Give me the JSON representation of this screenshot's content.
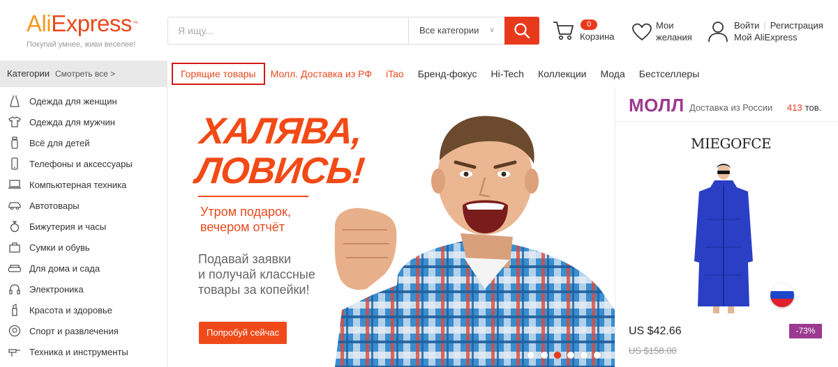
{
  "header": {
    "logo": {
      "ali": "Ali",
      "express": "Express",
      "tm": "™",
      "tagline": "Покупай умнее, живи веселее!"
    },
    "search": {
      "placeholder": "Я ищу...",
      "category": "Все категории",
      "button_icon": "search-icon"
    },
    "cart": {
      "count": "0",
      "label": "Корзина",
      "icon": "cart-icon"
    },
    "wishlist": {
      "line1": "Мои",
      "line2": "желания",
      "icon": "heart-icon"
    },
    "account": {
      "login": "Войти",
      "register": "Регистрация",
      "mine": "Мой AliExpress",
      "icon": "user-icon"
    }
  },
  "nav": {
    "categories_title": "Категории",
    "see_all": "Смотреть все >",
    "links": [
      {
        "label": "Горящие товары",
        "style": "hot"
      },
      {
        "label": "Молл. Доставка из РФ",
        "style": "orange"
      },
      {
        "label": "iTao",
        "style": "orange"
      },
      {
        "label": "Бренд-фокус",
        "style": "normal"
      },
      {
        "label": "Hi-Tech",
        "style": "normal"
      },
      {
        "label": "Коллекции",
        "style": "normal"
      },
      {
        "label": "Мода",
        "style": "normal"
      },
      {
        "label": "Бестселлеры",
        "style": "normal"
      }
    ]
  },
  "sidebar": {
    "items": [
      {
        "label": "Одежда для женщин",
        "icon": "dress-icon"
      },
      {
        "label": "Одежда для мужчин",
        "icon": "shirt-icon"
      },
      {
        "label": "Всё для детей",
        "icon": "baby-bottle-icon"
      },
      {
        "label": "Телефоны и аксессуары",
        "icon": "phone-icon"
      },
      {
        "label": "Компьютерная техника",
        "icon": "laptop-icon"
      },
      {
        "label": "Автотовары",
        "icon": "car-icon"
      },
      {
        "label": "Бижутерия и часы",
        "icon": "ring-icon"
      },
      {
        "label": "Сумки и обувь",
        "icon": "bag-icon"
      },
      {
        "label": "Для дома и сада",
        "icon": "sofa-icon"
      },
      {
        "label": "Электроника",
        "icon": "headphones-icon"
      },
      {
        "label": "Красота и здоровье",
        "icon": "lipstick-icon"
      },
      {
        "label": "Спорт и развлечения",
        "icon": "ball-icon"
      },
      {
        "label": "Техника и инструменты",
        "icon": "tools-icon"
      }
    ]
  },
  "banner": {
    "title_line1": "ХАЛЯВА,",
    "title_line2": "ЛОВИСЬ!",
    "sub_line1": "Утром подарок,",
    "sub_line2": "вечером отчёт",
    "text_line1": "Подавай заявки",
    "text_line2": "и получай классные",
    "text_line3": "товары за копейки!",
    "button": "Попробуй сейчас",
    "slides": 6,
    "active_slide": 3,
    "accent": "#f24a16"
  },
  "mall": {
    "title": "МОЛЛ",
    "subtitle": "Доставка из России",
    "count": "413",
    "count_unit": "тов.",
    "brand": "MIEGOFCE",
    "price": "US $42.66",
    "old_price": "US $158.00",
    "discount": "-73%",
    "accent": "#9b3a8f"
  }
}
